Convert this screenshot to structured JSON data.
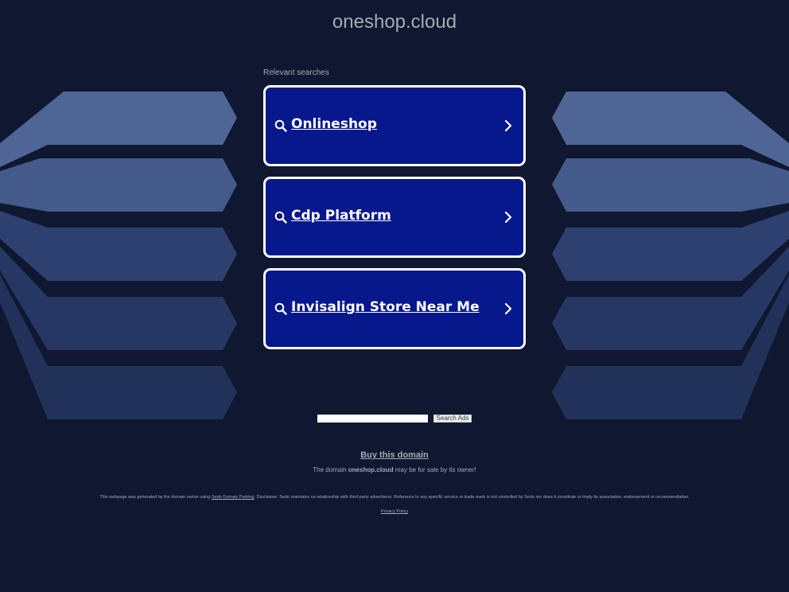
{
  "site": {
    "title": "oneshop.cloud"
  },
  "related": {
    "label": "Relevant searches",
    "items": [
      {
        "label": "Onlineshop"
      },
      {
        "label": "Cdp Platform"
      },
      {
        "label": "Invisalign Store Near Me"
      }
    ]
  },
  "search": {
    "button_label": "Search Ads",
    "input_value": ""
  },
  "buy": {
    "link_label": "Buy this domain",
    "sale_prefix": "The domain ",
    "sale_domain": "oneshop.cloud",
    "sale_suffix": " may be for sale by its owner!"
  },
  "footer": {
    "disclaimer_prefix": "This webpage was generated by the domain owner using ",
    "disclaimer_link": "Sedo Domain Parking",
    "disclaimer_suffix": ". Disclaimer: Sedo maintains no relationship with third party advertisers. Reference to any specific service or trade mark is not controlled by Sedo nor does it constitute or imply its association, endorsement or recommendation.",
    "privacy_label": "Privacy Policy"
  },
  "colors": {
    "background": "#0f1830",
    "card": "#06188c",
    "text_muted": "#a6aab3"
  }
}
